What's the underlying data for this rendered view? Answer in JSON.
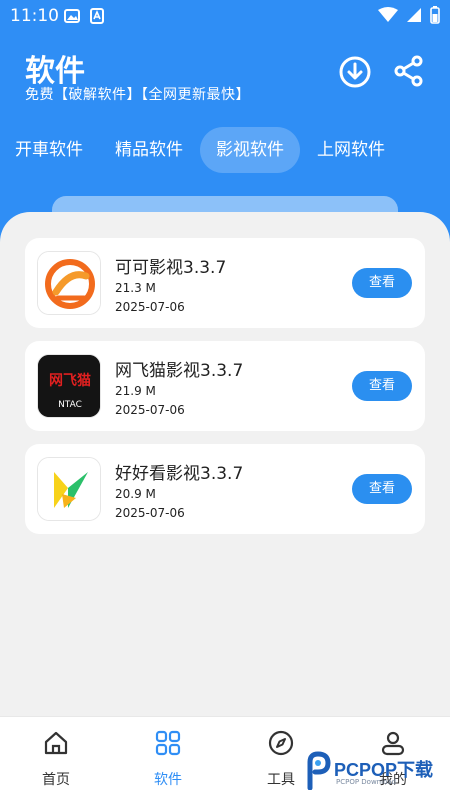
{
  "status_bar": {
    "time": "11:10"
  },
  "header": {
    "title": "软件",
    "subtitle": "免费【破解软件】【全网更新最快】",
    "accent_color": "#2f8ef5"
  },
  "tabs": [
    {
      "label": "开車软件",
      "active": false
    },
    {
      "label": "精品软件",
      "active": false
    },
    {
      "label": "影视软件",
      "active": true
    },
    {
      "label": "上网软件",
      "active": false
    }
  ],
  "apps": [
    {
      "name": "可可影视3.3.7",
      "size": "21.3 M",
      "date": "2025-07-06",
      "button": "查看"
    },
    {
      "name": "网飞猫影视3.3.7",
      "size": "21.9 M",
      "date": "2025-07-06",
      "button": "查看",
      "icon_text": "网飞猫",
      "icon_subtext": "NTAC"
    },
    {
      "name": "好好看影视3.3.7",
      "size": "20.9 M",
      "date": "2025-07-06",
      "button": "查看"
    }
  ],
  "bottom_nav": [
    {
      "label": "首页",
      "icon": "home-icon",
      "active": false
    },
    {
      "label": "软件",
      "icon": "grid-icon",
      "active": true
    },
    {
      "label": "工具",
      "icon": "compass-icon",
      "active": false
    },
    {
      "label": "我的",
      "icon": "user-icon",
      "active": false
    }
  ],
  "watermark": {
    "text": "PCPOP下载",
    "small": "PCPOP Download"
  }
}
